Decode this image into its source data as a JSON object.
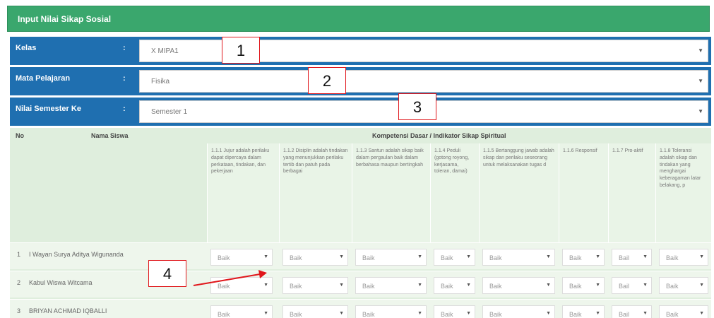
{
  "title": "Input Nilai Sikap Sosial",
  "filters": [
    {
      "label": "Kelas",
      "colon": ":",
      "value": "X MIPA1"
    },
    {
      "label": "Mata Pelajaran",
      "colon": ":",
      "value": "Fisika"
    },
    {
      "label": "Nilai Semester Ke",
      "colon": ":",
      "value": "Semester 1"
    }
  ],
  "table": {
    "col_no": "No",
    "col_name": "Nama Siswa",
    "col_kd": "Kompetensi Dasar / Indikator Sikap Spiritual",
    "kd": [
      "1.1.1 Jujur adalah perilaku dapat dipercaya dalam perkataan, tindakan, dan pekerjaan",
      "1.1.2 Disiplin adalah tindakan yang menunjukkan perilaku tertib dan patuh pada berbagai",
      "1.1.3 Santun adalah sikap baik dalam pergaulan baik dalam berbahasa maupun bertingkah",
      "1.1.4 Peduli (gotong royong, kerjasama, toleran, damai)",
      "1.1.5 Bertanggung jawab adalah sikap dan perilaku seseorang untuk melaksanakan tugas d",
      "1.1.6 Responsif",
      "1.1.7 Pro-aktif",
      "1.1.8 Toleransi adalah sikap dan tindakan yang menghargai keberagaman latar belakang, p"
    ],
    "students": [
      {
        "no": "1",
        "name": "I Wayan Surya Aditya Wigunanda",
        "grades": [
          "Baik",
          "Baik",
          "Baik",
          "Baik",
          "Baik",
          "Baik",
          "Bail",
          "Baik"
        ]
      },
      {
        "no": "2",
        "name": "Kabul Wiswa Witcama",
        "grades": [
          "Baik",
          "Baik",
          "Baik",
          "Baik",
          "Baik",
          "Baik",
          "Bail",
          "Baik"
        ]
      },
      {
        "no": "3",
        "name": "BRIYAN ACHMAD IQBALLI",
        "grades": [
          "Baik",
          "Baik",
          "Baik",
          "Baik",
          "Baik",
          "Baik",
          "Bail",
          "Baik"
        ]
      }
    ]
  },
  "callouts": [
    "1",
    "2",
    "3",
    "4"
  ],
  "icons": {
    "caret": "caret-down-icon"
  },
  "colors": {
    "title_bg": "#3aa76d",
    "filter_bg": "#1f6fb0",
    "table_bg": "#dfeedd",
    "callout_border": "#e0161b"
  }
}
